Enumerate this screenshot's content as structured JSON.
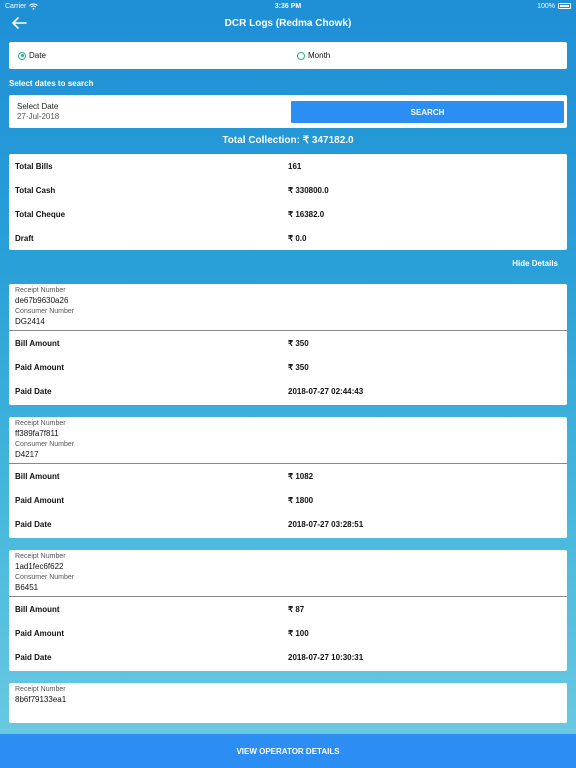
{
  "status_bar": {
    "carrier": "Carrier",
    "time": "3:36 PM",
    "battery": "100%"
  },
  "nav": {
    "title": "DCR Logs (Redma Chowk)"
  },
  "filter": {
    "option_date": "Date",
    "option_month": "Month",
    "selected": "Date"
  },
  "search_section": {
    "label": "Select dates to search",
    "date_label": "Select Date",
    "date_value": "27-Jul-2018",
    "button": "SEARCH"
  },
  "total_collection": "Total Collection: ₹ 347182.0",
  "summary": [
    {
      "key": "Total Bills",
      "value": "161"
    },
    {
      "key": "Total Cash",
      "value": "₹ 330800.0"
    },
    {
      "key": "Total Cheque",
      "value": "₹ 16382.0"
    },
    {
      "key": "Draft",
      "value": "₹ 0.0"
    }
  ],
  "hide_details": "Hide Details",
  "receipt_labels": {
    "receipt_number": "Receipt Number",
    "consumer_number": "Consumer Number",
    "bill_amount": "Bill Amount",
    "paid_amount": "Paid Amount",
    "paid_date": "Paid Date"
  },
  "receipts": [
    {
      "receipt_number": "de67b9630a26",
      "consumer_number": "DG2414",
      "bill_amount": "₹ 350",
      "paid_amount": "₹ 350",
      "paid_date": "2018-07-27 02:44:43"
    },
    {
      "receipt_number": "ff389fa7f811",
      "consumer_number": "D4217",
      "bill_amount": "₹ 1082",
      "paid_amount": "₹ 1800",
      "paid_date": "2018-07-27 03:28:51"
    },
    {
      "receipt_number": "1ad1fec6f622",
      "consumer_number": "B6451",
      "bill_amount": "₹ 87",
      "paid_amount": "₹ 100",
      "paid_date": "2018-07-27 10:30:31"
    },
    {
      "receipt_number": "8b6f79133ea1"
    }
  ],
  "bottom_button": "VIEW OPERATOR DETAILS",
  "colors": {
    "accent": "#2c8ef2",
    "radio": "#2bae8f"
  }
}
